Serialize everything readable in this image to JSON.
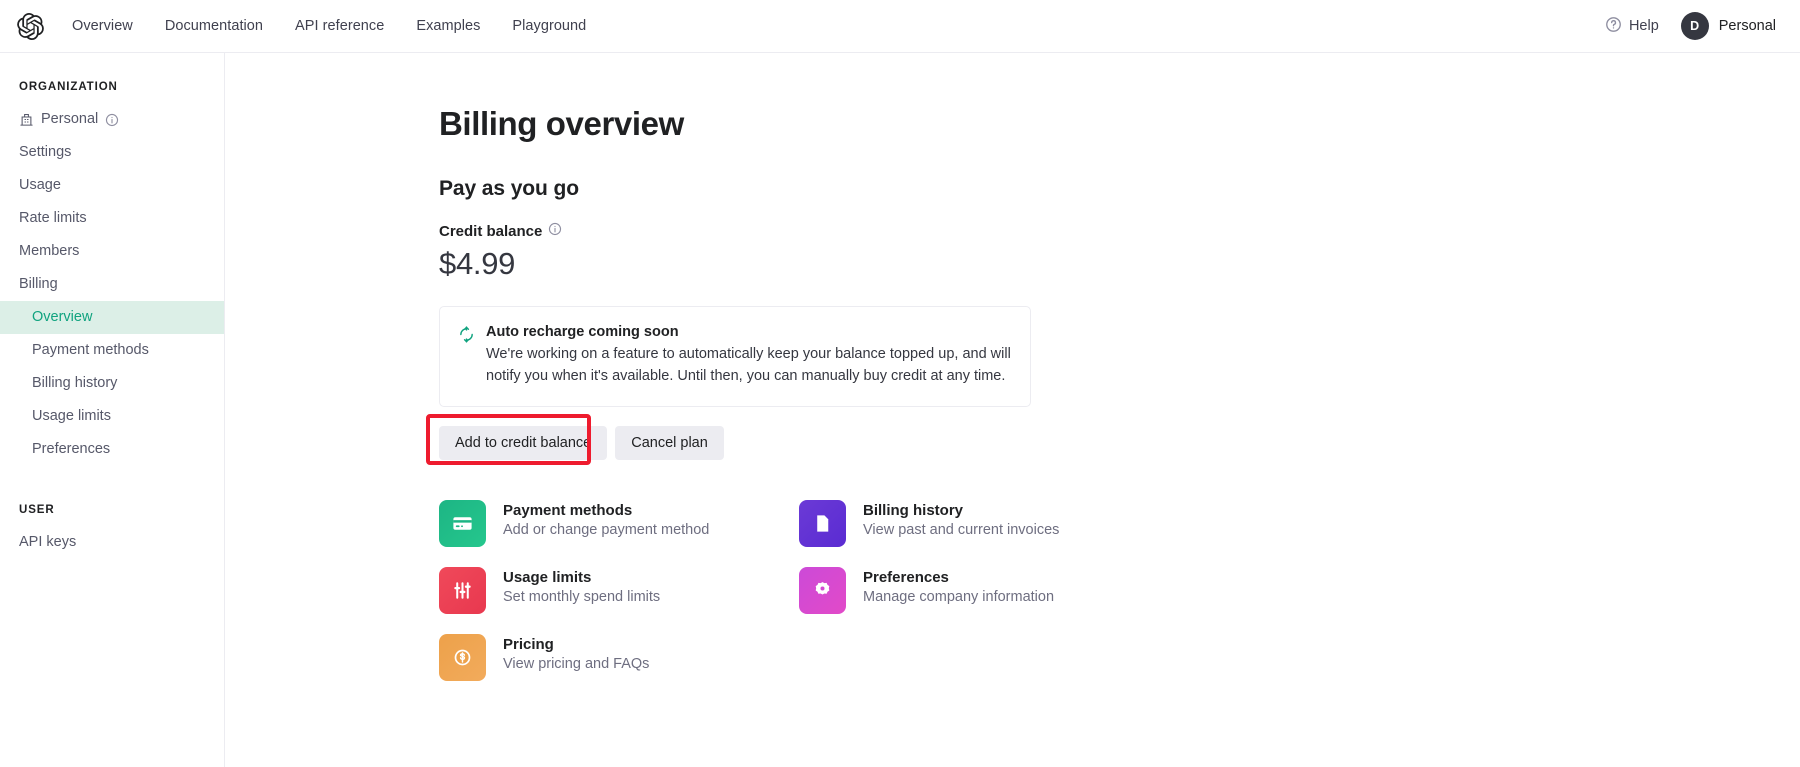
{
  "topnav": {
    "logo": "openai-logo-icon",
    "links": [
      {
        "label": "Overview",
        "name": "nav-link-overview"
      },
      {
        "label": "Documentation",
        "name": "nav-link-documentation"
      },
      {
        "label": "API reference",
        "name": "nav-link-api-reference"
      },
      {
        "label": "Examples",
        "name": "nav-link-examples"
      },
      {
        "label": "Playground",
        "name": "nav-link-playground"
      }
    ],
    "help_label": "Help",
    "help_icon": "question-circle-icon",
    "account_initial": "D",
    "account_label": "Personal"
  },
  "sidebar": {
    "organization_heading": "ORGANIZATION",
    "org_items": [
      {
        "label": "Personal",
        "icon": "building-icon",
        "info_icon": "info-circle-icon",
        "active": false
      },
      {
        "label": "Settings",
        "active": false
      },
      {
        "label": "Usage",
        "active": false
      },
      {
        "label": "Rate limits",
        "active": false
      },
      {
        "label": "Members",
        "active": false
      },
      {
        "label": "Billing",
        "active": false
      }
    ],
    "billing_sub_items": [
      {
        "label": "Overview",
        "active": true
      },
      {
        "label": "Payment methods",
        "active": false
      },
      {
        "label": "Billing history",
        "active": false
      },
      {
        "label": "Usage limits",
        "active": false
      },
      {
        "label": "Preferences",
        "active": false
      }
    ],
    "user_heading": "USER",
    "user_items": [
      {
        "label": "API keys",
        "active": false
      }
    ],
    "active_bg": "#dcefe7",
    "active_color": "#10a37f"
  },
  "main": {
    "page_title": "Billing overview",
    "section_title": "Pay as you go",
    "credit_balance_label": "Credit balance",
    "credit_balance_info_icon": "info-circle-icon",
    "credit_balance_value": "$4.99",
    "notice": {
      "icon": "refresh-cycle-icon",
      "icon_color": "#10a37f",
      "title": "Auto recharge coming soon",
      "body": "We're working on a feature to automatically keep your balance topped up, and will notify you when it's available. Until then, you can manually buy credit at any time."
    },
    "buttons": {
      "add_credit_label": "Add to credit balance",
      "cancel_plan_label": "Cancel plan",
      "highlight_color": "#ee1b2e",
      "highlight_target": "add-to-credit-balance-button"
    },
    "tiles": [
      {
        "title": "Payment methods",
        "desc": "Add or change payment method",
        "icon": "credit-card-icon",
        "color": "#1db584",
        "color2": "#22c48c"
      },
      {
        "title": "Billing history",
        "desc": "View past and current invoices",
        "icon": "document-icon",
        "color": "#6435d4",
        "color2": "#5b2ed6"
      },
      {
        "title": "Usage limits",
        "desc": "Set monthly spend limits",
        "icon": "sliders-icon",
        "color": "#ef4352",
        "color2": "#e83a58"
      },
      {
        "title": "Preferences",
        "desc": "Manage company information",
        "icon": "gear-icon",
        "color": "#d34ad3",
        "color2": "#e04ad0"
      },
      {
        "title": "Pricing",
        "desc": "View pricing and FAQs",
        "icon": "dollar-coin-icon",
        "color": "#eda14a",
        "color2": "#f0a755"
      }
    ]
  }
}
